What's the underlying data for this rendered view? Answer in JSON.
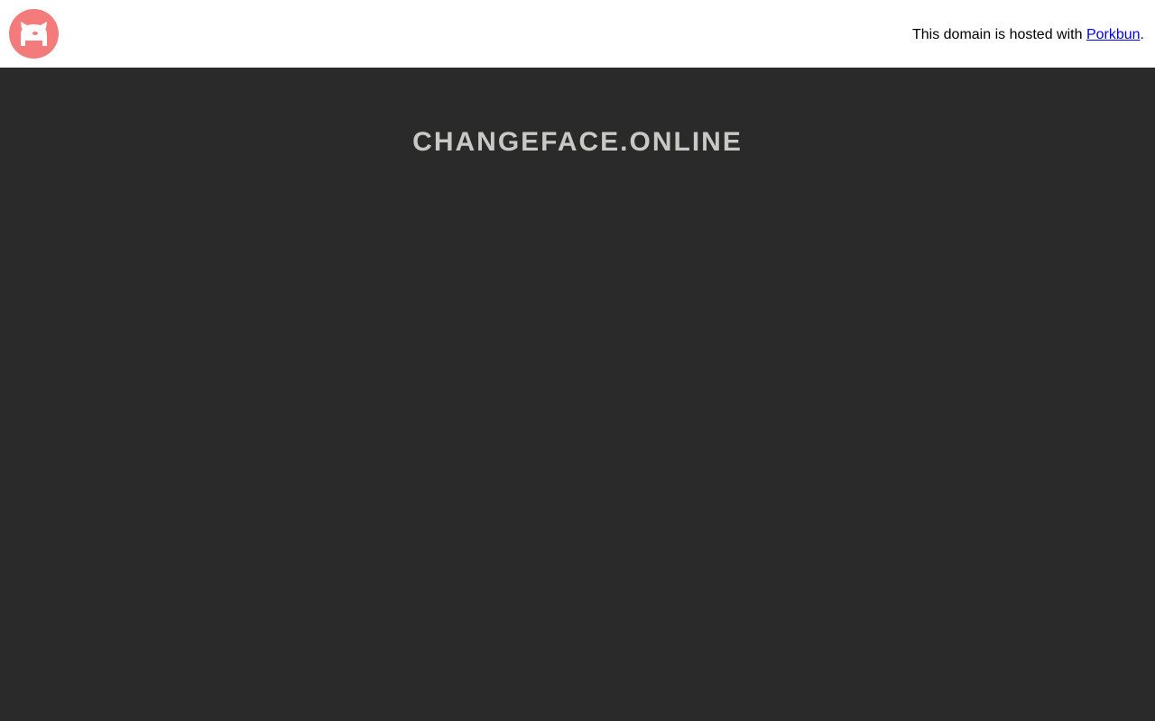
{
  "header": {
    "logo_icon": "porkbun-pig-icon",
    "logo_color": "#f47b7b",
    "hosted_prefix": "This domain is hosted with ",
    "hosted_link": "Porkbun",
    "hosted_suffix": "."
  },
  "main": {
    "domain": "CHANGEFACE.ONLINE",
    "background": "#2a2a2a",
    "title_color": "#c8c8c4"
  }
}
